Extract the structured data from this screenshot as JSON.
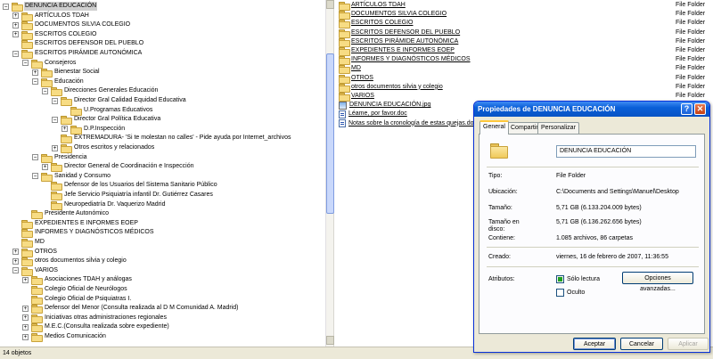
{
  "tree": [
    {
      "label": "DENUNCIA EDUCACIÓN",
      "level": 0,
      "expander": "minus",
      "selected": true
    },
    {
      "label": "ARTÍCULOS TDAH",
      "level": 1,
      "expander": "plus"
    },
    {
      "label": "DOCUMENTOS SILVIA COLEGIO",
      "level": 1,
      "expander": "plus"
    },
    {
      "label": "ESCRITOS COLEGIO",
      "level": 1,
      "expander": "plus"
    },
    {
      "label": "ESCRITOS DEFENSOR DEL PUEBLO",
      "level": 1,
      "expander": "none"
    },
    {
      "label": "ESCRITOS PIRÁMIDE AUTONÓMICA",
      "level": 1,
      "expander": "minus"
    },
    {
      "label": "Consejeros",
      "level": 2,
      "expander": "minus"
    },
    {
      "label": "Bienestar Social",
      "level": 3,
      "expander": "plus"
    },
    {
      "label": "Educación",
      "level": 3,
      "expander": "minus"
    },
    {
      "label": "Direcciones Generales Educación",
      "level": 4,
      "expander": "minus"
    },
    {
      "label": "Director Gral Calidad Equidad Educativa",
      "level": 5,
      "expander": "minus"
    },
    {
      "label": "U.Programas Educativos",
      "level": 6,
      "expander": "none"
    },
    {
      "label": "Director Gral Política Educativa",
      "level": 5,
      "expander": "minus"
    },
    {
      "label": "D.P.Inspección",
      "level": 6,
      "expander": "plus"
    },
    {
      "label": "EXTREMADURA- 'Si te molestan no calles' - Pide ayuda por Internet_archivos",
      "level": 5,
      "expander": "none"
    },
    {
      "label": "Otros escritos y relacionados",
      "level": 5,
      "expander": "plus"
    },
    {
      "label": "Presidencia",
      "level": 3,
      "expander": "minus"
    },
    {
      "label": "Director General de Coordinación e Inspección",
      "level": 4,
      "expander": "plus"
    },
    {
      "label": "Sanidad y Consumo",
      "level": 3,
      "expander": "minus"
    },
    {
      "label": "Defensor de los Usuarios del Sistema Sanitario Público",
      "level": 4,
      "expander": "none"
    },
    {
      "label": "Jefe Servicio Psiquiatría infantil Dr. Gutiérrez Casares",
      "level": 4,
      "expander": "none"
    },
    {
      "label": "Neuropediatría Dr. Vaquerizo Madrid",
      "level": 4,
      "expander": "none"
    },
    {
      "label": "Presidente Autonómico",
      "level": 2,
      "expander": "none"
    },
    {
      "label": "EXPEDIENTES E INFORMES EOEP",
      "level": 1,
      "expander": "none"
    },
    {
      "label": "INFORMES Y DIAGNÓSTICOS MÉDICOS",
      "level": 1,
      "expander": "none"
    },
    {
      "label": "MD",
      "level": 1,
      "expander": "none"
    },
    {
      "label": "OTROS",
      "level": 1,
      "expander": "plus"
    },
    {
      "label": "otros documentos silvia y colegio",
      "level": 1,
      "expander": "plus"
    },
    {
      "label": "VARIOS",
      "level": 1,
      "expander": "minus"
    },
    {
      "label": "Asociaciones TDAH y análogas",
      "level": 2,
      "expander": "plus"
    },
    {
      "label": "Colegio Oficial de Neurólogos",
      "level": 2,
      "expander": "none"
    },
    {
      "label": "Colegio Oficial de Psiquiatras I.",
      "level": 2,
      "expander": "none"
    },
    {
      "label": "Defensor del Menor (Consulta realizada al D M Comunidad A. Madrid)",
      "level": 2,
      "expander": "plus"
    },
    {
      "label": "Iniciativas otras administraciones regionales",
      "level": 2,
      "expander": "plus"
    },
    {
      "label": "M.E.C.(Consulta realizada sobre expediente)",
      "level": 2,
      "expander": "plus"
    },
    {
      "label": "Medios Comunicación",
      "level": 2,
      "expander": "plus"
    }
  ],
  "files": [
    {
      "name": "ARTÍCULOS TDAH",
      "type": "File Folder",
      "icon": "folder-icon"
    },
    {
      "name": "DOCUMENTOS SILVIA COLEGIO",
      "type": "File Folder",
      "icon": "folder-icon"
    },
    {
      "name": "ESCRITOS COLEGIO",
      "type": "File Folder",
      "icon": "folder-icon"
    },
    {
      "name": "ESCRITOS DEFENSOR DEL PUEBLO",
      "type": "File Folder",
      "icon": "folder-icon"
    },
    {
      "name": "ESCRITOS PIRÁMIDE AUTONÓMICA",
      "type": "File Folder",
      "icon": "folder-icon"
    },
    {
      "name": "EXPEDIENTES E INFORMES EOEP",
      "type": "File Folder",
      "icon": "folder-icon"
    },
    {
      "name": "INFORMES Y DIAGNÓSTICOS MÉDICOS",
      "type": "File Folder",
      "icon": "folder-icon"
    },
    {
      "name": "MD",
      "type": "File Folder",
      "icon": "folder-icon"
    },
    {
      "name": "OTROS",
      "type": "File Folder",
      "icon": "folder-icon"
    },
    {
      "name": "otros documentos silvia y colegio",
      "type": "File Folder",
      "icon": "folder-icon"
    },
    {
      "name": "VARIOS",
      "type": "File Folder",
      "icon": "folder-icon"
    },
    {
      "name": "DENUNCIA EDUCACIÓN.jpg",
      "type": "",
      "icon": "image-file-icon"
    },
    {
      "name": "Léame, por favor.doc",
      "type": "",
      "icon": "word-doc-icon"
    },
    {
      "name": "Notas sobre la cronología de estas quejas.doc",
      "type": "",
      "icon": "word-doc-icon"
    }
  ],
  "status_bar": {
    "text": "14 objetos"
  },
  "dialog": {
    "title": "Propiedades de DENUNCIA EDUCACIÓN",
    "help": "?",
    "close": "✕",
    "tabs": [
      "General",
      "Compartir",
      "Personalizar"
    ],
    "active_tab": "General",
    "name_value": "DENUNCIA EDUCACIÓN",
    "props": {
      "tipo_label": "Tipo:",
      "tipo_value": "File Folder",
      "ubicacion_label": "Ubicación:",
      "ubicacion_value": "C:\\Documents and Settings\\Manuel\\Desktop",
      "tamano_label": "Tamaño:",
      "tamano_value": "5,71 GB (6.133.204.009 bytes)",
      "tamano_disco_label": "Tamaño en disco:",
      "tamano_disco_value": "5,71 GB (6.136.262.656 bytes)",
      "contiene_label": "Contiene:",
      "contiene_value": "1.085 archivos, 86 carpetas",
      "creado_label": "Creado:",
      "creado_value": "viernes, 16 de febrero de 2007, 11:36:55",
      "atributos_label": "Atributos:"
    },
    "attributes": {
      "solo_lectura": "Sólo lectura",
      "oculto": "Oculto",
      "opciones": "Opciones avanzadas..."
    },
    "buttons": {
      "ok": "Aceptar",
      "cancel": "Cancelar",
      "apply": "Aplicar"
    }
  }
}
